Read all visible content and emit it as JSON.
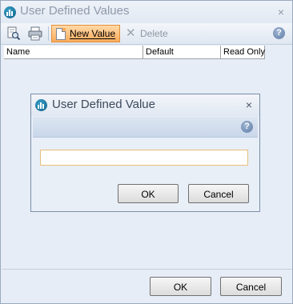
{
  "main_window": {
    "title": "User Defined Values",
    "close_glyph": "×",
    "toolbar": {
      "preview_icon": "print-preview-icon",
      "print_icon": "printer-icon",
      "new_value_label": "New Value",
      "delete_label": "Delete",
      "help_glyph": "?"
    },
    "grid": {
      "columns": [
        "Name",
        "Default",
        "Read Only"
      ],
      "rows": []
    },
    "ok_label": "OK",
    "cancel_label": "Cancel"
  },
  "dialog": {
    "title": "User Defined Value",
    "close_glyph": "×",
    "help_glyph": "?",
    "input_value": "",
    "ok_label": "OK",
    "cancel_label": "Cancel"
  },
  "colors": {
    "accent_button": "#f9ab5c",
    "window_background": "#e6edf6",
    "help_icon": "#5f7ea8"
  }
}
